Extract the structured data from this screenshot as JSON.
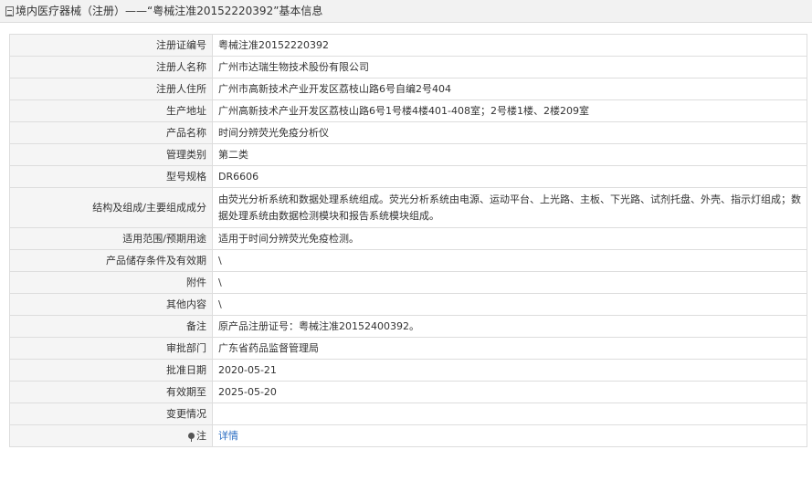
{
  "header": {
    "icon": "document-icon",
    "title": "境内医疗器械（注册）——“粤械注准20152220392”基本信息"
  },
  "rows": [
    {
      "label": "注册证编号",
      "value": "粤械注准20152220392"
    },
    {
      "label": "注册人名称",
      "value": "广州市达瑞生物技术股份有限公司"
    },
    {
      "label": "注册人住所",
      "value": "广州市高新技术产业开发区荔枝山路6号自编2号404"
    },
    {
      "label": "生产地址",
      "value": "广州高新技术产业开发区荔枝山路6号1号楼4楼401-408室；2号楼1楼、2楼209室"
    },
    {
      "label": "产品名称",
      "value": "时间分辨荧光免疫分析仪"
    },
    {
      "label": "管理类别",
      "value": "第二类"
    },
    {
      "label": "型号规格",
      "value": "DR6606"
    },
    {
      "label": "结构及组成/主要组成成分",
      "value": "由荧光分析系统和数据处理系统组成。荧光分析系统由电源、运动平台、上光路、主板、下光路、试剂托盘、外壳、指示灯组成；数据处理系统由数据检测模块和报告系统模块组成。"
    },
    {
      "label": "适用范围/预期用途",
      "value": "适用于时间分辨荧光免疫检测。"
    },
    {
      "label": "产品储存条件及有效期",
      "value": "\\"
    },
    {
      "label": "附件",
      "value": "\\"
    },
    {
      "label": "其他内容",
      "value": "\\"
    },
    {
      "label": "备注",
      "value": "原产品注册证号：粤械注准20152400392。"
    },
    {
      "label": "审批部门",
      "value": "广东省药品监督管理局"
    },
    {
      "label": "批准日期",
      "value": "2020-05-21"
    },
    {
      "label": "有效期至",
      "value": "2025-05-20"
    },
    {
      "label": "变更情况",
      "value": ""
    }
  ],
  "note": {
    "icon": "pin-icon",
    "label": "注",
    "link": "详情"
  }
}
